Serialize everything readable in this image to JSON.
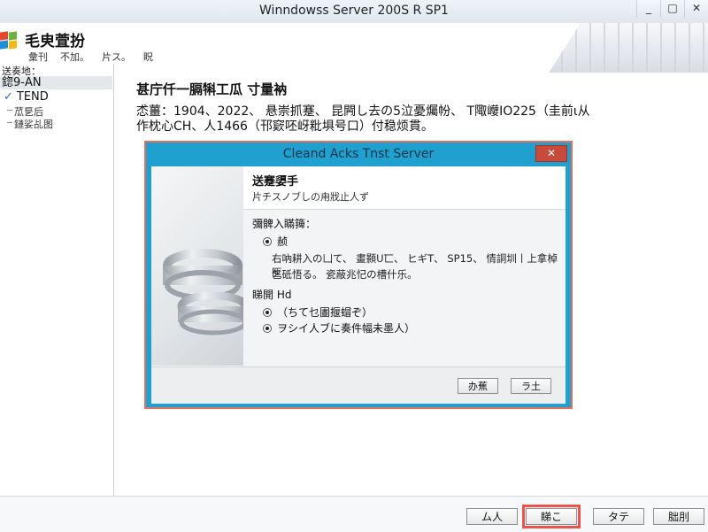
{
  "window": {
    "title": "Winndowss Server 200S R SP1",
    "controls": [
      "_",
      "□",
      "✕"
    ]
  },
  "header": {
    "app_name": "毛㬰萓扮",
    "menu": [
      "彙刊",
      "不加。",
      "片ス。",
      "眖"
    ]
  },
  "sidebar": {
    "heading": "送奏地：",
    "selected": "鍃9-AN",
    "item": {
      "check": "✓",
      "label": "TEND"
    },
    "children": [
      "苽乬后",
      "鏈娑乩图"
    ]
  },
  "main": {
    "title": "甚庁仟一膈犐工瓜 寸量衲",
    "line1": "怸薑：1904、2022、 悬崇抓蹇、 昆闁し去の5泣憂爥帉、 T陬巕IO225（圭前ι从",
    "line2": "作枕心CH、人1466（邗窽呸岈粃埧号口）付稳烦貫。"
  },
  "dialog": {
    "title": "Cleand Acks Tnst Server",
    "close": "✕",
    "heading": "送蹇嬃手",
    "subheading": "片チスノブしの甪戕止人ず",
    "options_label": "彌髀入瞞篺：",
    "option1": "赪",
    "para1": "右吶耕入の凵て、 畫顥U匸、 ヒギT、 SP15、 情詷圳丨上拿棹匜",
    "para2": "乞砥悟る。 瓷蔽兆忋の槽什乐。",
    "label2": "睇開 Hd",
    "option2": "（ちて乜圕揠蝐ぞ）",
    "option3": "ヲシイ人ブに奏件幅未墨人）",
    "buttons": {
      "next": "办蕉",
      "cancel": "ラ土"
    }
  },
  "footer": {
    "buttons": [
      "ム人",
      "睇こ",
      "タテ",
      "朏刖"
    ]
  }
}
